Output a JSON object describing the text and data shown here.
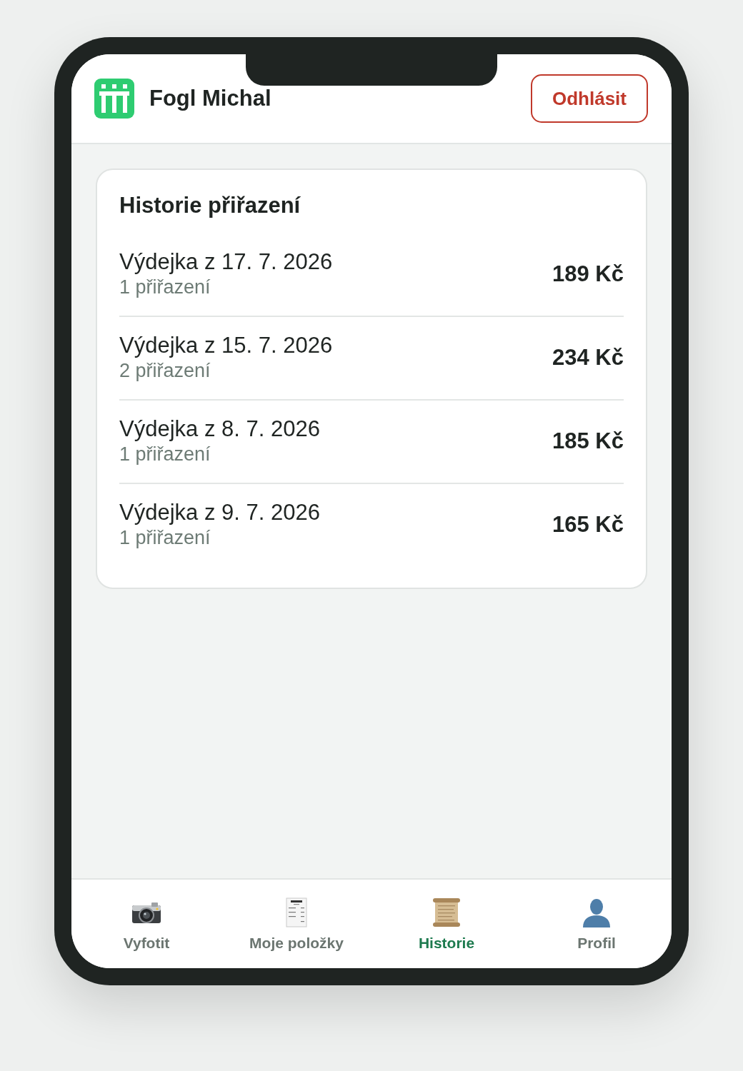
{
  "header": {
    "user_name": "Fogl Michal",
    "logout_button": "Odhlásit"
  },
  "history": {
    "title": "Historie přiřazení",
    "entries": [
      {
        "title": "Výdejka z 17. 7. 2026",
        "count": "1 přiřazení",
        "amount": "189 Kč"
      },
      {
        "title": "Výdejka z 15. 7. 2026",
        "count": "2 přiřazení",
        "amount": "234 Kč"
      },
      {
        "title": "Výdejka z 8. 7. 2026",
        "count": "1 přiřazení",
        "amount": "185 Kč"
      },
      {
        "title": "Výdejka z 9. 7. 2026",
        "count": "1 přiřazení",
        "amount": "165 Kč"
      }
    ]
  },
  "tab_bar": {
    "tabs": [
      {
        "label": "Vyfotit",
        "selected": false
      },
      {
        "label": "Moje položky",
        "selected": false
      },
      {
        "label": "Historie",
        "selected": true
      },
      {
        "label": "Profil",
        "selected": false
      }
    ]
  }
}
